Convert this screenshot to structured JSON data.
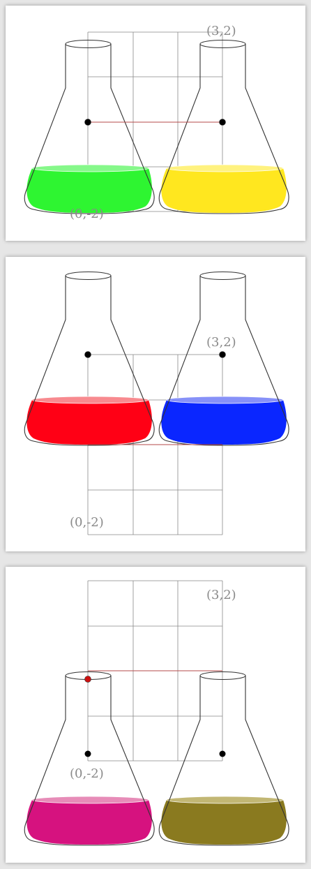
{
  "colors": {
    "grid": "#888888",
    "link": "#b54a4a",
    "label": "#8a8a8a"
  },
  "panels": [
    {
      "labels": {
        "top_right": "(3,2)",
        "bottom_left": "(0,-2)"
      },
      "flasks": [
        {
          "name": "left",
          "liquid_color": "#2ef531",
          "liquid_top_color": "#86f88a",
          "liquid_level": 0.4
        },
        {
          "name": "right",
          "liquid_color": "#ffe71f",
          "liquid_top_color": "#fff27f",
          "liquid_level": 0.4
        }
      ],
      "marker": {
        "color": "#000000"
      }
    },
    {
      "labels": {
        "top_right": "(3,2)",
        "bottom_left": "(0,-2)"
      },
      "flasks": [
        {
          "name": "left",
          "liquid_color": "#ff0015",
          "liquid_top_color": "#f88a8f",
          "liquid_level": 0.4
        },
        {
          "name": "right",
          "liquid_color": "#0a26ff",
          "liquid_top_color": "#8791f8",
          "liquid_level": 0.4
        }
      ],
      "marker": {
        "color": "#000000"
      }
    },
    {
      "labels": {
        "top_right": "(3,2)",
        "bottom_left": "(0,-2)"
      },
      "flasks": [
        {
          "name": "left",
          "liquid_color": "#d6127f",
          "liquid_top_color": "#e78cb8",
          "liquid_level": 0.4
        },
        {
          "name": "right",
          "liquid_color": "#8a7a1f",
          "liquid_top_color": "#c2b774",
          "liquid_level": 0.4
        }
      ],
      "marker": {
        "color": "#cc1111"
      }
    }
  ]
}
